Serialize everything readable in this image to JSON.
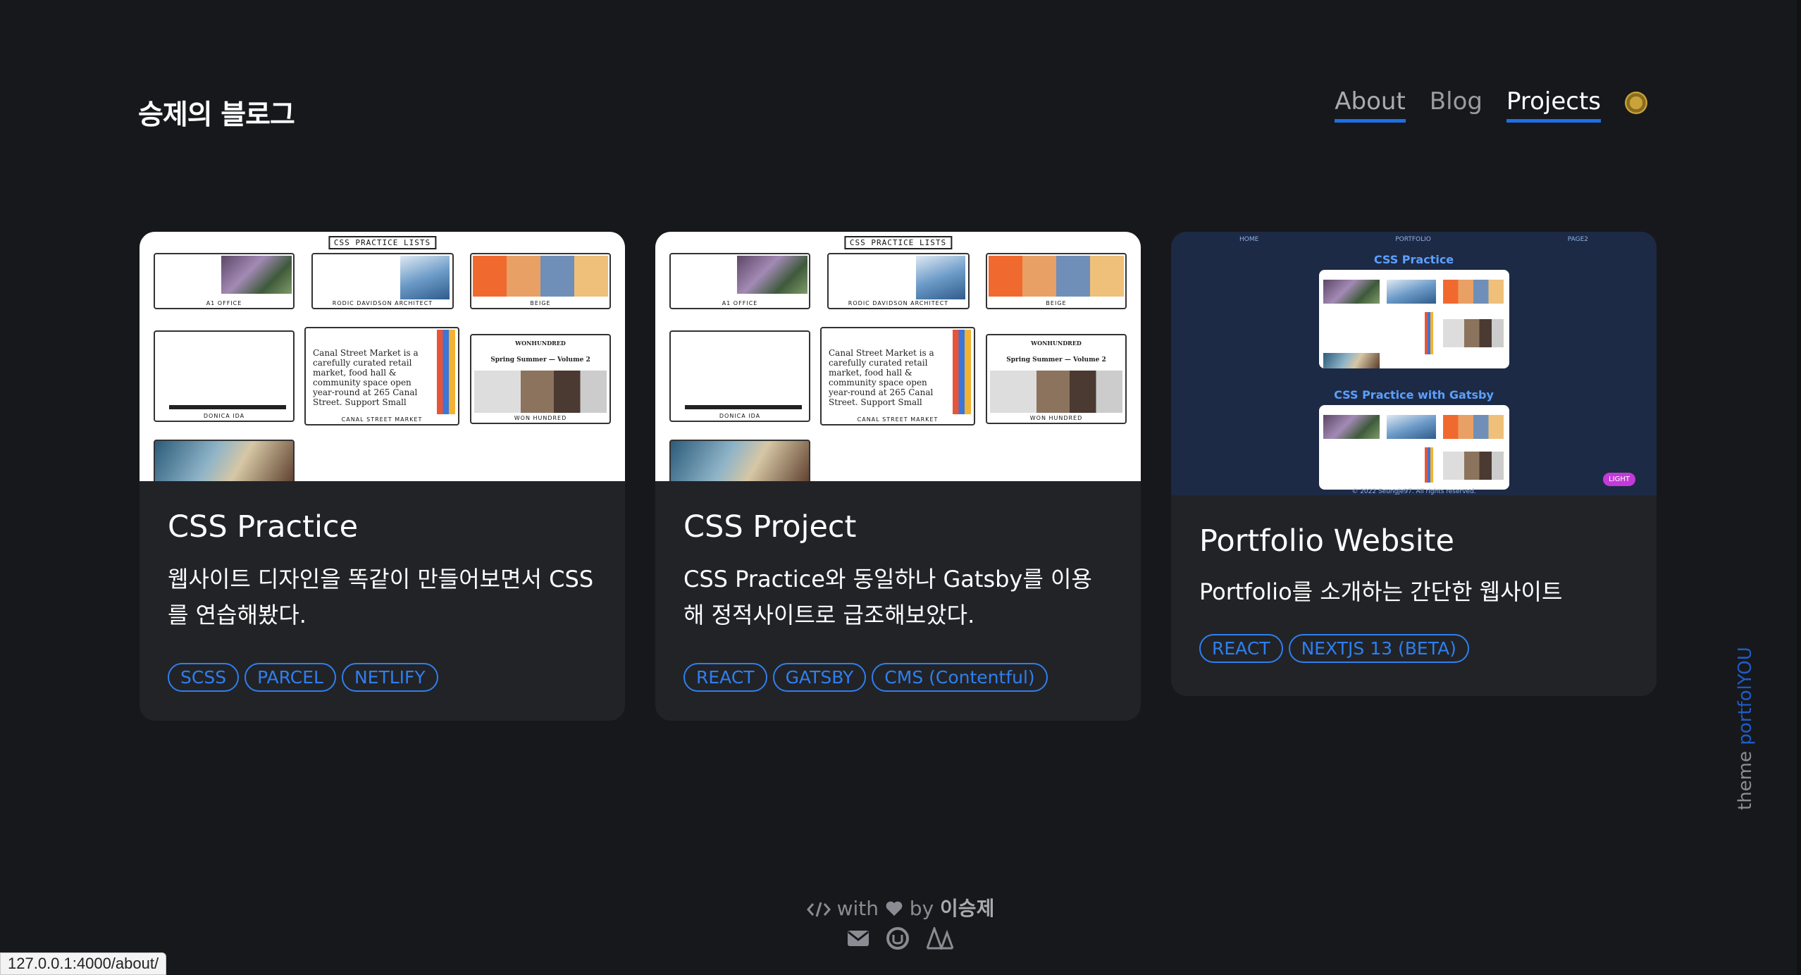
{
  "site": {
    "title": "승제의 블로그"
  },
  "nav": {
    "items": [
      {
        "label": "About"
      },
      {
        "label": "Blog"
      },
      {
        "label": "Projects"
      }
    ],
    "theme_toggle_icon": "sun-icon"
  },
  "projects": [
    {
      "title": "CSS Practice",
      "description": "웹사이트 디자인을 똑같이 만들어보면서 CSS를 연습해봤다.",
      "tags": [
        "SCSS",
        "PARCEL",
        "NETLIFY"
      ],
      "thumbnail": {
        "heading": "CSS PRACTICE LISTS",
        "captions": [
          "A1 OFFICE",
          "RODIC DAVIDSON ARCHITECT",
          "BEIGE",
          "DONICA IDA",
          "CANAL STREET MARKET",
          "WON HUNDRED"
        ],
        "snippet": "Canal Street Market is a carefully curated retail market, food hall & community space open year-round at 265 Canal Street. Support Small",
        "spring": "Spring Summer — Volume 2",
        "brand": "WONHUNDRED"
      }
    },
    {
      "title": "CSS Project",
      "description": "CSS Practice와 동일하나 Gatsby를 이용해 정적사이트로 급조해보았다.",
      "tags": [
        "REACT",
        "GATSBY",
        "CMS (Contentful)"
      ],
      "thumbnail": {
        "heading": "CSS PRACTICE LISTS",
        "captions": [
          "A1 OFFICE",
          "RODIC DAVIDSON ARCHITECT",
          "BEIGE",
          "DONICA IDA",
          "CANAL STREET MARKET",
          "WON HUNDRED"
        ],
        "snippet": "Canal Street Market is a carefully curated retail market, food hall & community space open year-round at 265 Canal Street. Support Small",
        "spring": "Spring Summer — Volume 2",
        "brand": "WONHUNDRED"
      }
    },
    {
      "title": "Portfolio Website",
      "description": "Portfolio를 소개하는 간단한 웹사이트",
      "tags": [
        "REACT",
        "NEXTJS 13 (BETA)"
      ],
      "thumbnail": {
        "nav": [
          "HOME",
          "PORTFOLIO",
          "PAGE2"
        ],
        "section1": "CSS Practice",
        "section2": "CSS Practice with Gatsby",
        "badge": "LIGHT",
        "footer": "© 2022 Seungje97. All rights reserved."
      }
    }
  ],
  "side_label": {
    "prefix": "theme ",
    "accent": "portfolYOU"
  },
  "footer": {
    "with": "with",
    "by": "by",
    "author": "이승제",
    "icons": [
      "code-icon",
      "heart-icon",
      "mail-icon",
      "github-icon",
      "velog-icon"
    ]
  },
  "status_url": "127.0.0.1:4000/about/",
  "colors": {
    "background": "#17181b",
    "card": "#222327",
    "accent": "#1e6fe8",
    "tag": "#2e7ff0"
  }
}
